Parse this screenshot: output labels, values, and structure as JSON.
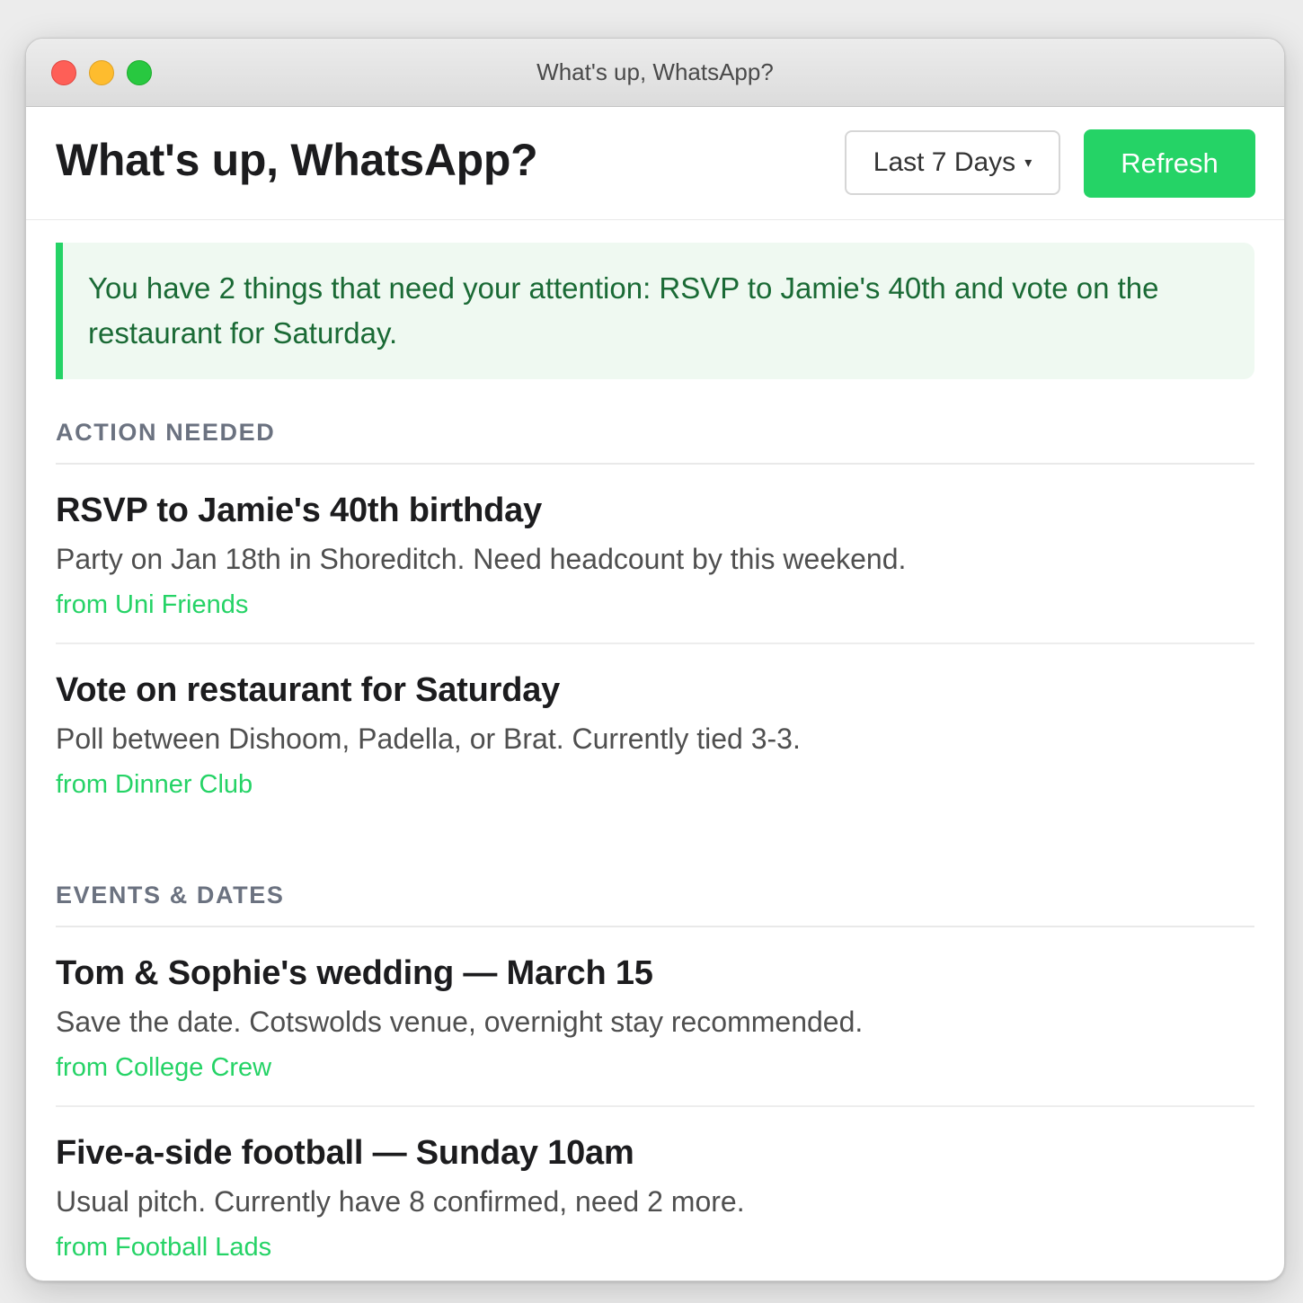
{
  "window": {
    "title": "What's up, WhatsApp?"
  },
  "header": {
    "title": "What's up, WhatsApp?",
    "range_select": {
      "value": "Last 7 Days",
      "caret": "▾"
    },
    "refresh_label": "Refresh"
  },
  "summary": {
    "text": "You have 2 things that need your attention: RSVP to Jamie's 40th and vote on the restaurant for Saturday."
  },
  "sections": [
    {
      "heading": "ACTION NEEDED",
      "items": [
        {
          "title": "RSVP to Jamie's 40th birthday",
          "description": "Party on Jan 18th in Shoreditch. Need headcount by this weekend.",
          "source": "from Uni Friends"
        },
        {
          "title": "Vote on restaurant for Saturday",
          "description": "Poll between Dishoom, Padella, or Brat. Currently tied 3-3.",
          "source": "from Dinner Club"
        }
      ]
    },
    {
      "heading": "EVENTS & DATES",
      "items": [
        {
          "title": "Tom & Sophie's wedding — March 15",
          "description": "Save the date. Cotswolds venue, overnight stay recommended.",
          "source": "from College Crew"
        },
        {
          "title": "Five-a-side football — Sunday 10am",
          "description": "Usual pitch. Currently have 8 confirmed, need 2 more.",
          "source": "from Football Lads"
        }
      ]
    }
  ],
  "colors": {
    "accent": "#25d366",
    "summary_background": "#eff9f1",
    "summary_text": "#1a6a35",
    "section_heading": "#6b7280"
  }
}
